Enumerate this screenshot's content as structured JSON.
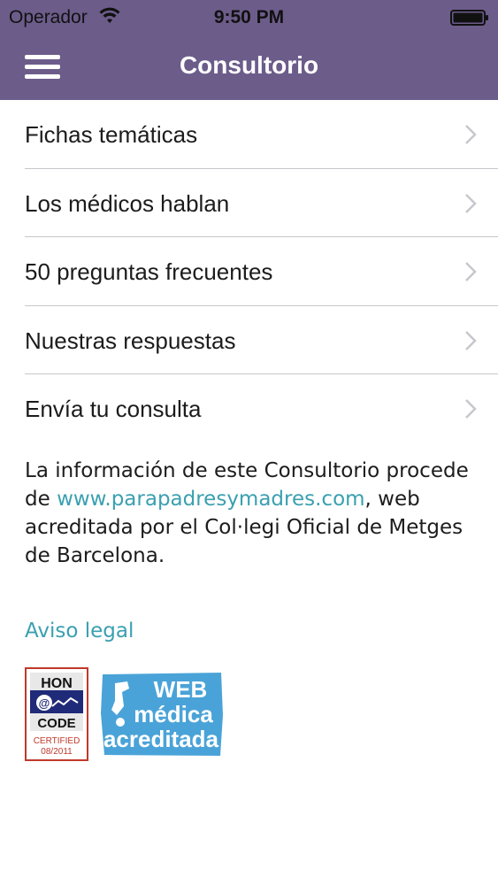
{
  "status_bar": {
    "carrier": "Operador",
    "time": "9:50 PM"
  },
  "nav": {
    "title": "Consultorio"
  },
  "menu": {
    "items": [
      {
        "label": "Fichas temáticas"
      },
      {
        "label": "Los médicos hablan"
      },
      {
        "label": "50 preguntas frecuentes"
      },
      {
        "label": "Nuestras respuestas"
      },
      {
        "label": "Envía tu consulta"
      }
    ]
  },
  "info": {
    "text_before": "La información de este Consultorio procede de ",
    "link": "www.parapadresymadres.com",
    "text_after": ", web acreditada por el Col·legi Oficial de Metges de Barcelona."
  },
  "legal": {
    "link": "Aviso legal"
  },
  "badges": {
    "hon": {
      "top": "HON",
      "bottom": "CODE",
      "certified": "CERTIFIED",
      "date": "08/2011"
    },
    "web": {
      "line1": "WEB",
      "line2": "médica",
      "line3": "acreditada"
    }
  },
  "colors": {
    "header": "#6c5c8a",
    "link": "#3aa0b0",
    "separator": "#c8c7cc",
    "chevron": "#c7c7cc"
  }
}
